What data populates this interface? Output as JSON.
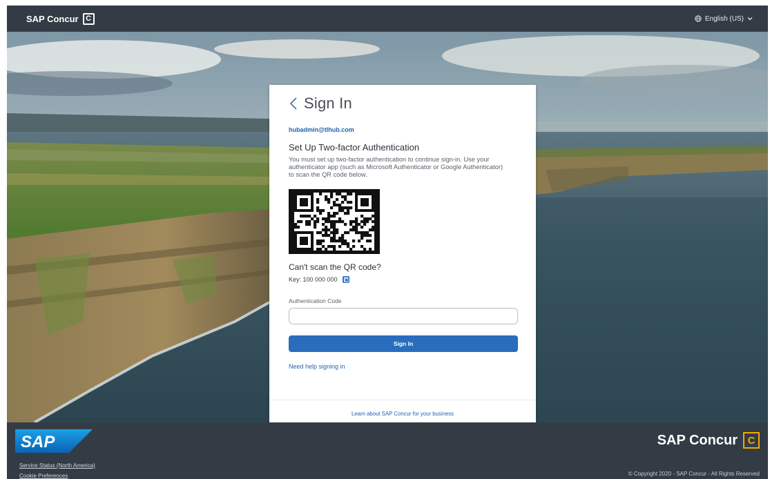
{
  "header": {
    "brand": "SAP Concur",
    "brand_icon": "C",
    "language": "English (US)"
  },
  "card": {
    "title": "Sign In",
    "email": "hubadmin@tlhub.com",
    "heading": "Set Up Two-factor Authentication",
    "description": "You must set up two-factor authentication to continue sign-in. Use your authenticator app (such as Microsoft Authenticator or Google Authenticator) to scan the QR code below.",
    "cant_scan": "Can't scan the QR code?",
    "key_label": "Key: 100 000 000",
    "auth_code_label": "Authentication Code",
    "auth_code_value": "",
    "sign_in_button": "Sign In",
    "help_link": "Need help signing in",
    "learn_link": "Learn about SAP Concur for your business"
  },
  "footer": {
    "sap_logo": "SAP",
    "concur_brand": "SAP Concur",
    "concur_icon": "C",
    "links": [
      "Service Status (North America)",
      "Cookie Preferences"
    ],
    "copyright": "© Copyright 2020 - SAP Concur - All Rights Reserved"
  },
  "colors": {
    "header_bg": "#333c45",
    "primary_button": "#2a6dbd",
    "link": "#1f63ad",
    "concur_accent": "#f0ab00",
    "sap_blue": "#1f8de0"
  }
}
